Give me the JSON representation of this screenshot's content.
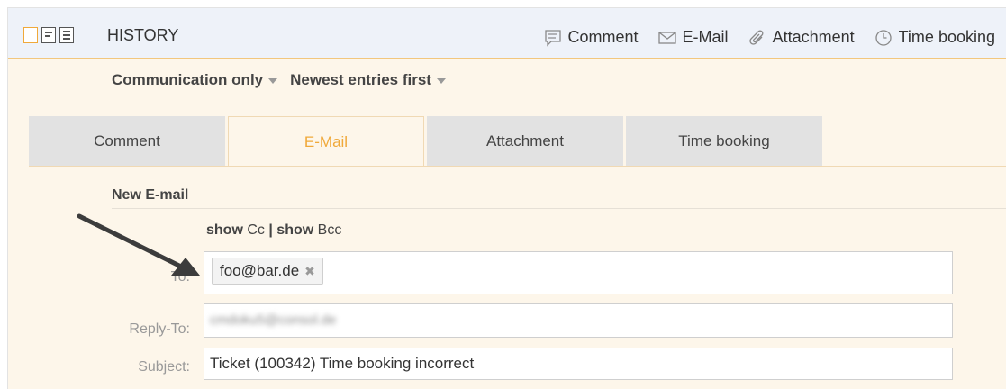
{
  "header": {
    "title": "HISTORY",
    "view_icons": [
      "single-column-view-icon",
      "two-column-view-icon",
      "list-view-icon"
    ],
    "tools": [
      {
        "label": "Comment",
        "icon": "comment-icon"
      },
      {
        "label": "E-Mail",
        "icon": "envelope-icon"
      },
      {
        "label": "Attachment",
        "icon": "paperclip-icon"
      },
      {
        "label": "Time booking",
        "icon": "clock-icon"
      }
    ]
  },
  "filters": {
    "type_filter": "Communication only",
    "sort_order": "Newest entries first"
  },
  "tabs": [
    {
      "label": "Comment",
      "active": false
    },
    {
      "label": "E-Mail",
      "active": true
    },
    {
      "label": "Attachment",
      "active": false
    },
    {
      "label": "Time booking",
      "active": false
    }
  ],
  "form": {
    "section_title": "New E-mail",
    "show_word": "show",
    "cc_label": "Cc",
    "separator": "|",
    "bcc_label": "Bcc",
    "to_label": "To:",
    "to_recipient": "foo@bar.de",
    "reply_to_label": "Reply-To:",
    "reply_to_value": "cmdoku5@consol.de",
    "subject_label": "Subject:",
    "subject_value": "Ticket (100342) Time booking incorrect"
  },
  "colors": {
    "accent": "#f0a93a",
    "panel_bg": "#fdf6ea",
    "header_bg": "#eef2f9",
    "tab_bg": "#e2e2e2"
  }
}
